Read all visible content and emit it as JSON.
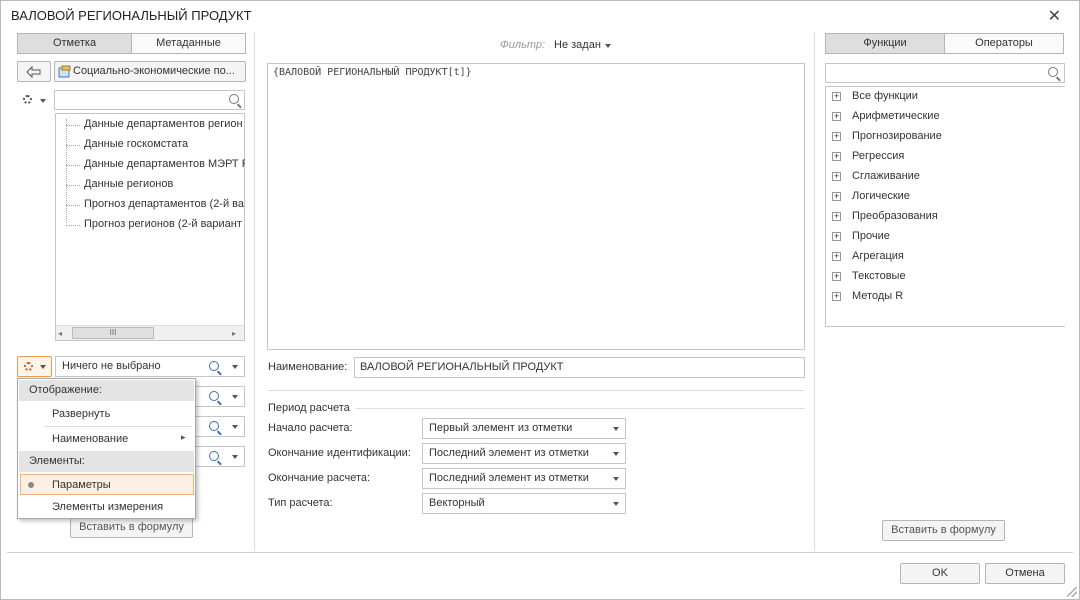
{
  "window": {
    "title": "ВАЛОВОЙ РЕГИОНАЛЬНЫЙ ПРОДУКТ"
  },
  "left": {
    "tabs": [
      "Отметка",
      "Метаданные"
    ],
    "source_label": "Социально-экономические по...",
    "tree_items": [
      "Данные департаментов регион",
      "Данные госкомстата",
      "Данные департаментов МЭРТ Р",
      "Данные регионов",
      "Прогноз департаментов (2-й ва",
      "Прогноз регионов (2-й вариант"
    ],
    "scroll_thumb": "III",
    "selection_value": "Ничего не выбрано",
    "insert_button": "Вставить в формулу"
  },
  "menu": {
    "display_header": "Отображение:",
    "expand": "Развернуть",
    "naming": "Наименование",
    "elements_header": "Элементы:",
    "parameters": "Параметры",
    "dimension_elements": "Элементы измерения"
  },
  "center": {
    "filter_label": "Фильтр:",
    "filter_value": "Не задан",
    "formula": "{ВАЛОВОЙ РЕГИОНАЛЬНЫЙ ПРОДУКТ[t]}",
    "name_label": "Наименование:",
    "name_value": "ВАЛОВОЙ РЕГИОНАЛЬНЫЙ ПРОДУКТ",
    "period_title": "Период расчета",
    "start_label": "Начало расчета:",
    "start_value": "Первый элемент из отметки",
    "ident_end_label": "Окончание идентификации:",
    "ident_end_value": "Последний элемент из отметки",
    "calc_end_label": "Окончание расчета:",
    "calc_end_value": "Последний элемент из отметки",
    "calc_type_label": "Тип расчета:",
    "calc_type_value": "Векторный"
  },
  "right": {
    "tabs": [
      "Функции",
      "Операторы"
    ],
    "functions": [
      "Все функции",
      "Арифметические",
      "Прогнозирование",
      "Регрессия",
      "Сглаживание",
      "Логические",
      "Преобразования",
      "Прочие",
      "Агрегация",
      "Текстовые",
      "Методы R"
    ],
    "insert_button": "Вставить в формулу"
  },
  "footer": {
    "ok": "OK",
    "cancel": "Отмена"
  }
}
